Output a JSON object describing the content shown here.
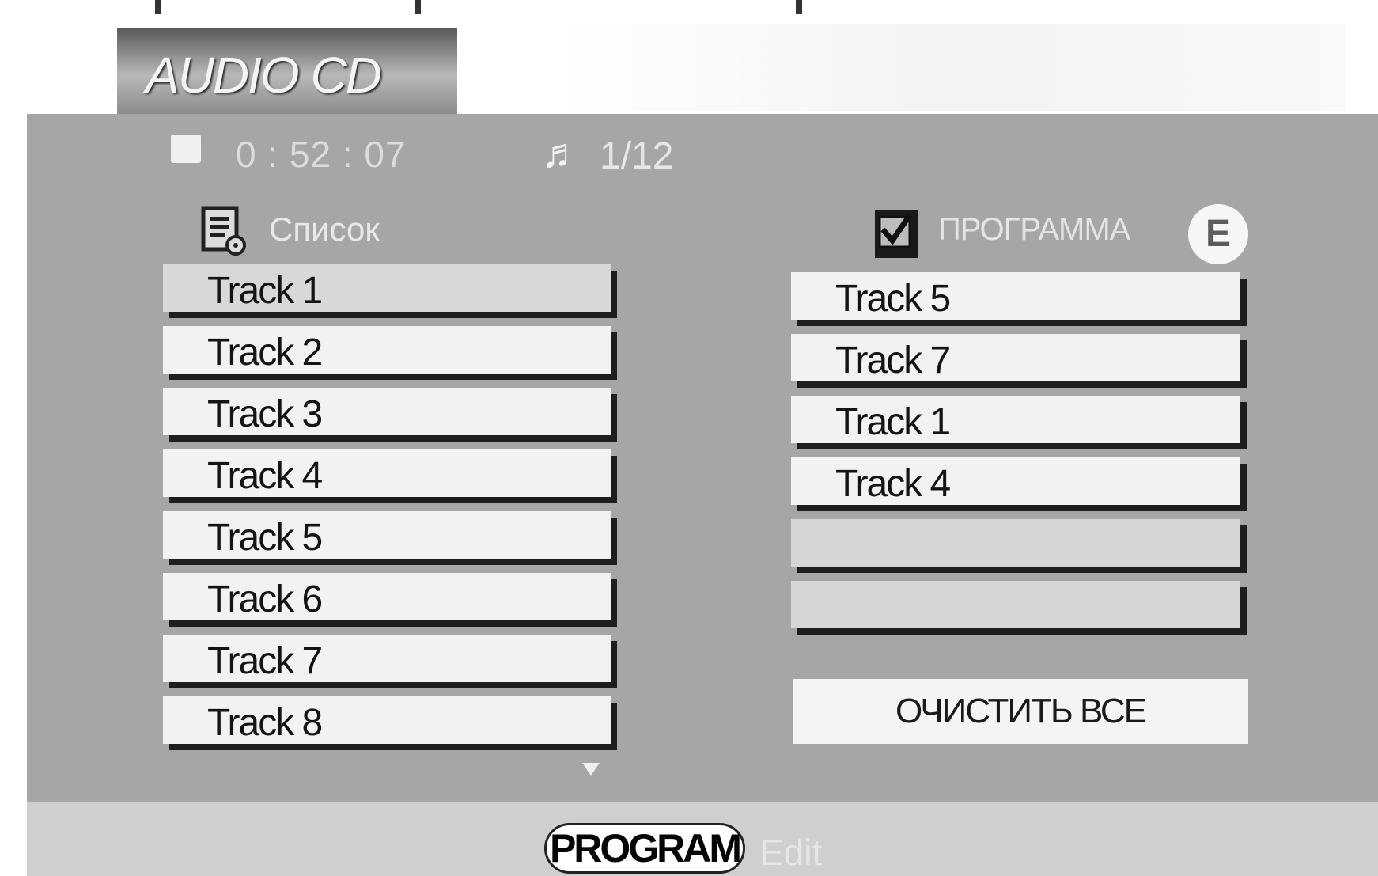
{
  "header": {
    "title": "AUDIO CD"
  },
  "status": {
    "time": "0 : 52 : 07",
    "track_counter": "1/12"
  },
  "list_panel": {
    "label": "Список",
    "tracks": [
      "Track 1",
      "Track 2",
      "Track 3",
      "Track 4",
      "Track 5",
      "Track 6",
      "Track 7",
      "Track 8"
    ]
  },
  "program_panel": {
    "label": "ПРОГРАММА",
    "tracks": [
      "Track 5",
      "Track 7",
      "Track 1",
      "Track 4",
      "",
      ""
    ],
    "clear_all_label": "ОЧИСТИТЬ ВСЕ",
    "e_badge": "E"
  },
  "footer": {
    "program_button": "PROGRAM",
    "edit_label": "Edit"
  },
  "icons": {
    "stop": "stop-icon",
    "note": "music-note-icon",
    "list": "list-icon",
    "checkbox": "checkbox-checked-icon",
    "scroll": "scroll-down-icon"
  }
}
